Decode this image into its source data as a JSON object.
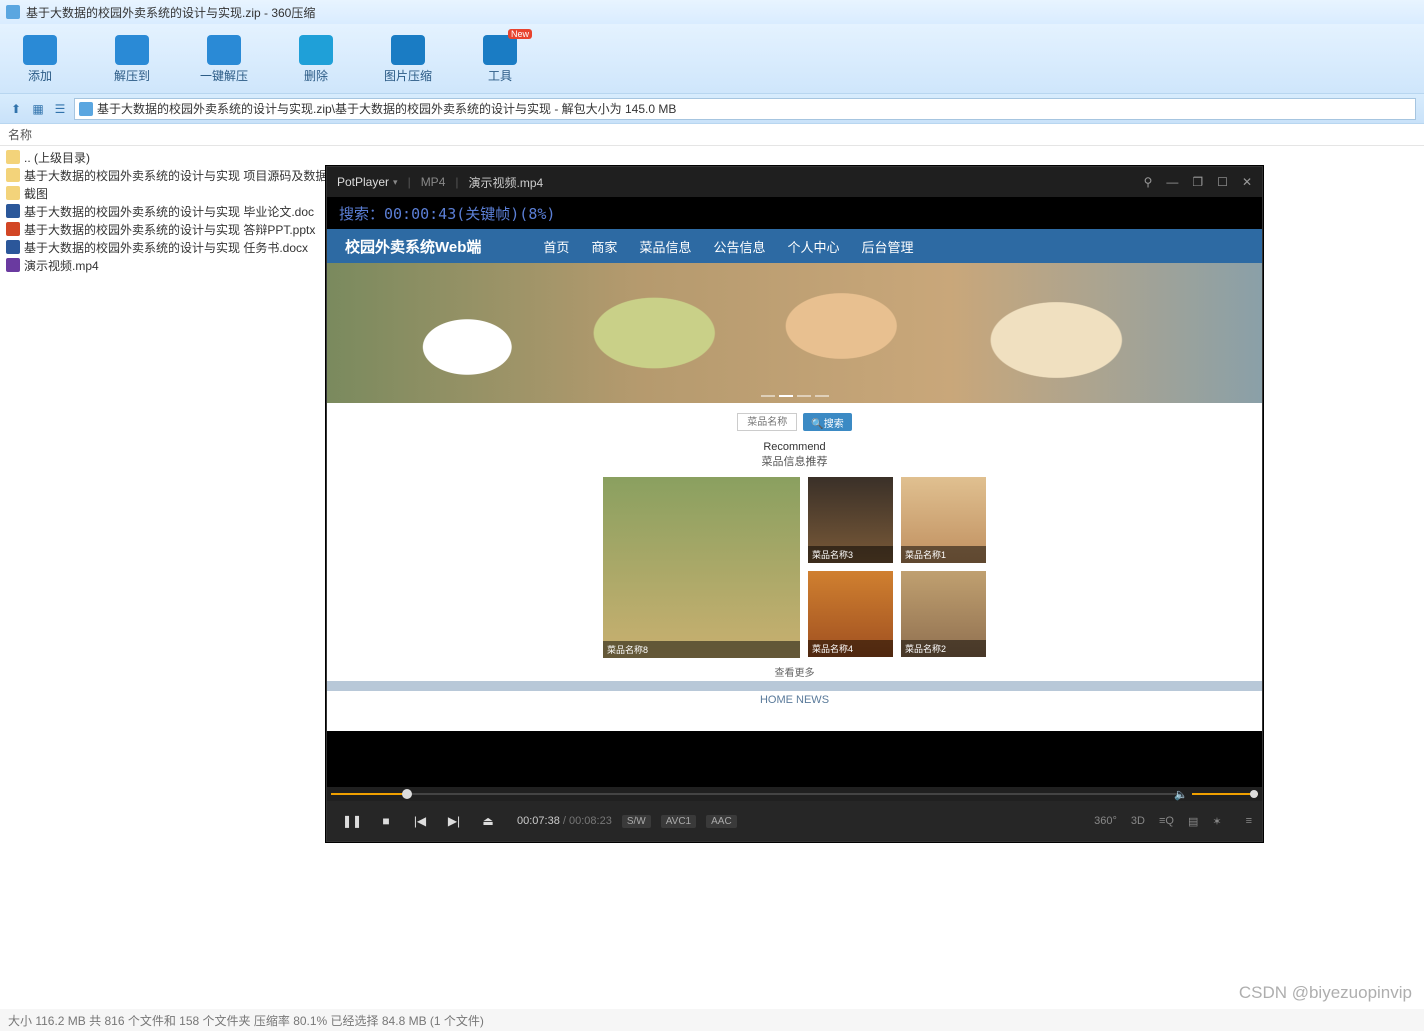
{
  "window": {
    "title": "基于大数据的校园外卖系统的设计与实现.zip - 360压缩"
  },
  "toolbar": [
    {
      "label": "添加"
    },
    {
      "label": "解压到"
    },
    {
      "label": "一键解压"
    },
    {
      "label": "删除"
    },
    {
      "label": "图片压缩"
    },
    {
      "label": "工具",
      "badge": "New"
    }
  ],
  "path": "基于大数据的校园外卖系统的设计与实现.zip\\基于大数据的校园外卖系统的设计与实现 - 解包大小为 145.0 MB",
  "list_header": "名称",
  "files": [
    {
      "name": ".. (上级目录)",
      "type": "fld"
    },
    {
      "name": "基于大数据的校园外卖系统的设计与实现 项目源码及数据库文",
      "type": "fld"
    },
    {
      "name": "截图",
      "type": "fld"
    },
    {
      "name": "基于大数据的校园外卖系统的设计与实现 毕业论文.doc",
      "type": "doc"
    },
    {
      "name": "基于大数据的校园外卖系统的设计与实现 答辩PPT.pptx",
      "type": "ppt"
    },
    {
      "name": "基于大数据的校园外卖系统的设计与实现 任务书.docx",
      "type": "doc"
    },
    {
      "name": "演示视频.mp4",
      "type": "mp4"
    }
  ],
  "status": "大小 116.2 MB 共 816 个文件和 158 个文件夹 压缩率 80.1% 已经选择 84.8 MB (1 个文件)",
  "watermark": "CSDN @biyezuopinvip",
  "player": {
    "app": "PotPlayer",
    "fmt": "MP4",
    "file": "演示视频.mp4",
    "overlay": "搜索：00:00:43(关键帧)(8%)",
    "cur": "00:07:38",
    "dur": "00:08:23",
    "tags": [
      "S/W",
      "AVC1",
      "AAC"
    ],
    "right": [
      "360°",
      "3D",
      "≡Q",
      "▤",
      "✶",
      "≡"
    ]
  },
  "web": {
    "brand": "校园外卖系统Web端",
    "nav": [
      "首页",
      "商家",
      "菜品信息",
      "公告信息",
      "个人中心",
      "后台管理"
    ],
    "search_ph": "菜品名称",
    "search_btn": "🔍搜索",
    "rec_en": "Recommend",
    "rec_cn": "菜品信息推荐",
    "caps": [
      "菜品名称8",
      "菜品名称3",
      "菜品名称1",
      "菜品名称4",
      "菜品名称2"
    ],
    "more": "查看更多",
    "hn": "HOME NEWS"
  }
}
